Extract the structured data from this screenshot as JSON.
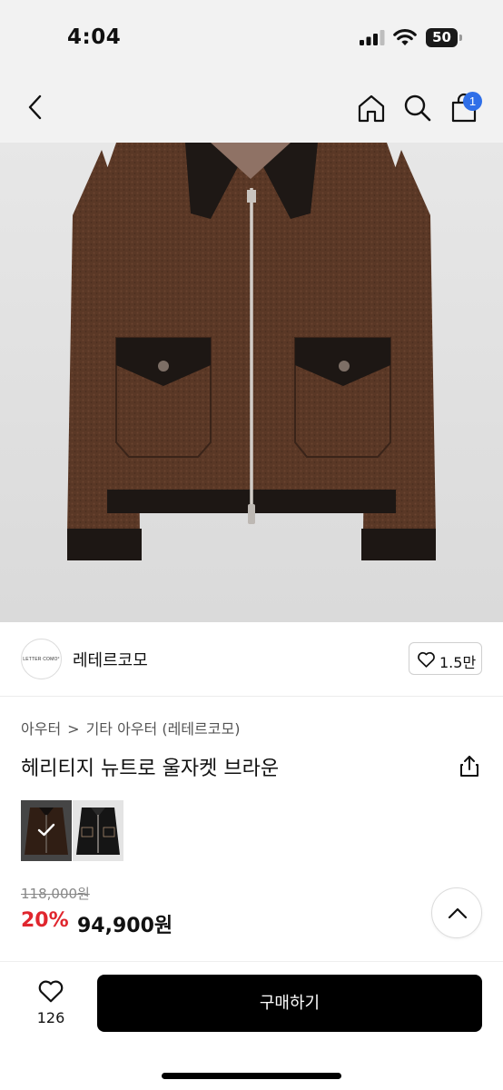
{
  "status_bar": {
    "time": "4:04",
    "battery_level": "50",
    "icons": [
      "signal-icon",
      "wifi-icon",
      "battery-icon"
    ]
  },
  "nav": {
    "icons": [
      "back-icon",
      "home-icon",
      "search-icon",
      "cart-icon"
    ],
    "cart_badge": "1",
    "badge_color": "#2f6fe8"
  },
  "brand": {
    "logo_text": "LETTER COMO°",
    "name": "레테르코모",
    "like_count": "1.5만"
  },
  "breadcrumb": {
    "level1": "아우터",
    "separator": ">",
    "level2": "기타 아우터 (레테르코모)"
  },
  "product": {
    "title": "헤리티지 뉴트로 울자켓 브라운",
    "options": [
      {
        "color": "brown",
        "selected": true
      },
      {
        "color": "black",
        "selected": false
      }
    ]
  },
  "price": {
    "original": "118,000원",
    "discount": "20%",
    "sale": "94,900원",
    "discount_color": "#e0262e"
  },
  "bottom_bar": {
    "wish_count": "126",
    "buy_label": "구매하기"
  }
}
